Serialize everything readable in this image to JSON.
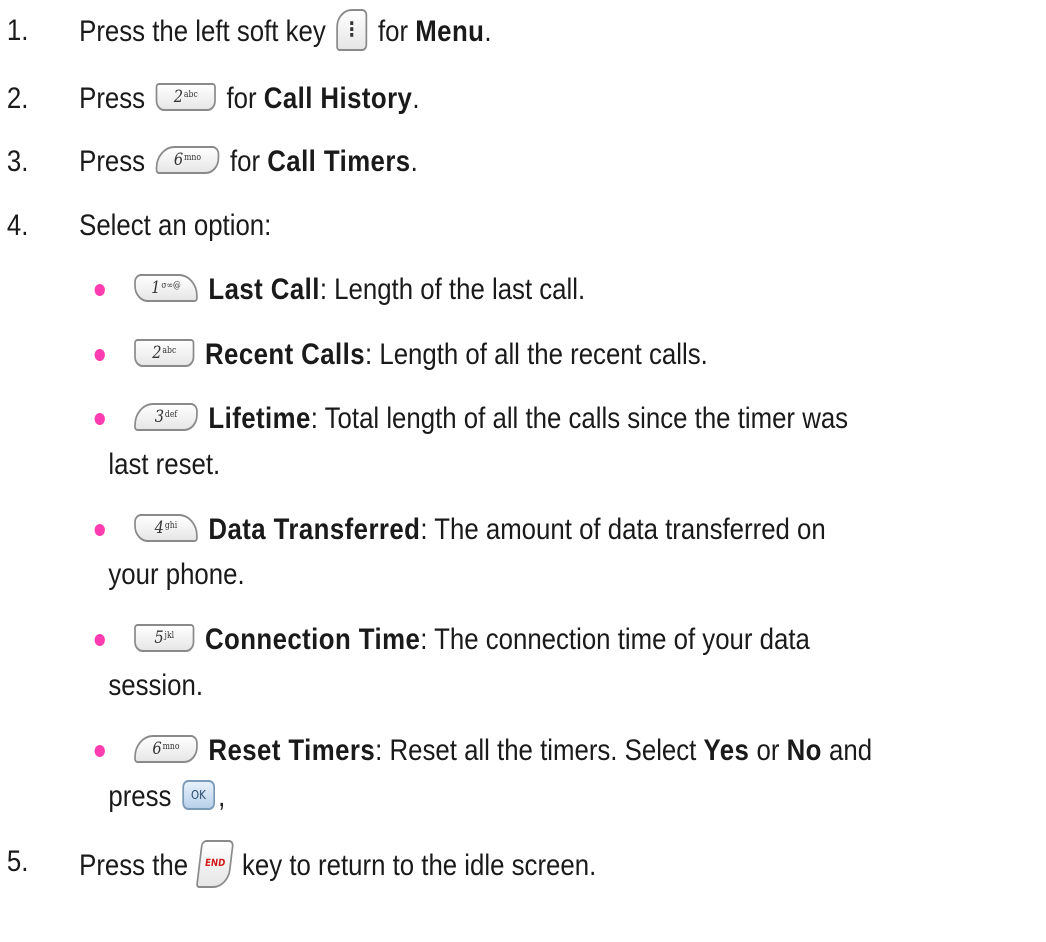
{
  "steps": [
    {
      "number": "1.",
      "before": "Press the left soft key",
      "after_key": "for",
      "bold": "Menu",
      "end": "."
    },
    {
      "number": "2.",
      "before": "Press",
      "after_key": "for",
      "bold": "Call History",
      "end": "."
    },
    {
      "number": "3.",
      "before": "Press",
      "after_key": "for",
      "bold": "Call Timers",
      "end": "."
    },
    {
      "number": "4.",
      "text": "Select an option:"
    },
    {
      "number": "5.",
      "before": "Press the",
      "after": "key to return to the idle screen."
    }
  ],
  "options": [
    {
      "title": "Last Call",
      "desc": ": Length of the last call."
    },
    {
      "title": "Recent Calls",
      "desc": ": Length of all the recent calls."
    },
    {
      "title": "Lifetime",
      "desc": ": Total length of all the calls since the timer was",
      "desc2": "last reset."
    },
    {
      "title": "Data Transferred",
      "desc": ": The amount of data transferred on",
      "desc2": "your phone."
    },
    {
      "title": "Connection Time",
      "desc": ": The connection time of your data",
      "desc2": "session."
    },
    {
      "title": "Reset Timers",
      "desc": ": Reset all the timers. Select",
      "yes": "Yes",
      "or": "or",
      "no": "No",
      "and": "and",
      "press": "press",
      "comma": ","
    }
  ],
  "keys": {
    "soft": {
      "glyph": "⋮",
      "icon": "left-soft-key-icon"
    },
    "k1": {
      "main": "1",
      "sub": "σ∞@",
      "icon": "key-1-icon"
    },
    "k2": {
      "main": "2",
      "sub": "abc",
      "icon": "key-2-icon"
    },
    "k3": {
      "main": "3",
      "sub": "def",
      "icon": "key-3-icon"
    },
    "k4": {
      "main": "4",
      "sub": "ghi",
      "icon": "key-4-icon"
    },
    "k5": {
      "main": "5",
      "sub": "jkl",
      "icon": "key-5-icon"
    },
    "k6": {
      "main": "6",
      "sub": "mno",
      "icon": "key-6-icon"
    },
    "ok": {
      "label": "OK",
      "icon": "ok-key-icon"
    },
    "end": {
      "label": "END",
      "icon": "end-key-icon"
    }
  },
  "colors": {
    "bullet": "#ff3db0",
    "text": "#1a1a1a"
  }
}
